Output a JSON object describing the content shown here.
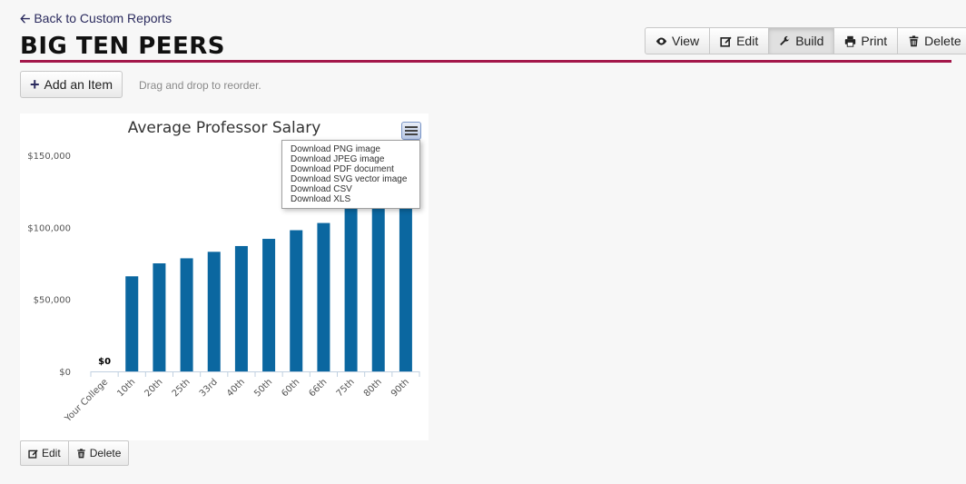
{
  "nav": {
    "back_label": "Back to Custom Reports"
  },
  "page": {
    "title": "BIG TEN PEERS"
  },
  "toolbar": {
    "view_label": "View",
    "edit_label": "Edit",
    "build_label": "Build",
    "print_label": "Print",
    "delete_label": "Delete",
    "active": "Build"
  },
  "builder": {
    "add_item_label": "Add an Item",
    "drag_hint": "Drag and drop to reorder."
  },
  "export_menu": {
    "items": [
      "Download PNG image",
      "Download JPEG image",
      "Download PDF document",
      "Download SVG vector image",
      "Download CSV",
      "Download XLS"
    ]
  },
  "item_actions": {
    "edit_label": "Edit",
    "delete_label": "Delete"
  },
  "colors": {
    "accent_rule": "#a3174a",
    "bar": "#0b67a0"
  },
  "chart_data": {
    "type": "bar",
    "title": "Average Professor Salary",
    "categories": [
      "Your College",
      "10th",
      "20th",
      "25th",
      "33rd",
      "40th",
      "50th",
      "60th",
      "66th",
      "75th",
      "80th",
      "90th"
    ],
    "values": [
      0,
      66000,
      75000,
      78500,
      83000,
      87000,
      92000,
      98000,
      103000,
      113000,
      120000,
      130000
    ],
    "y_ticks": [
      "$0",
      "$50,000",
      "$100,000",
      "$150,000"
    ],
    "ylim": [
      0,
      150000
    ],
    "data_labels": [
      {
        "category": "Your College",
        "text": "$0"
      }
    ],
    "legend": "none"
  }
}
